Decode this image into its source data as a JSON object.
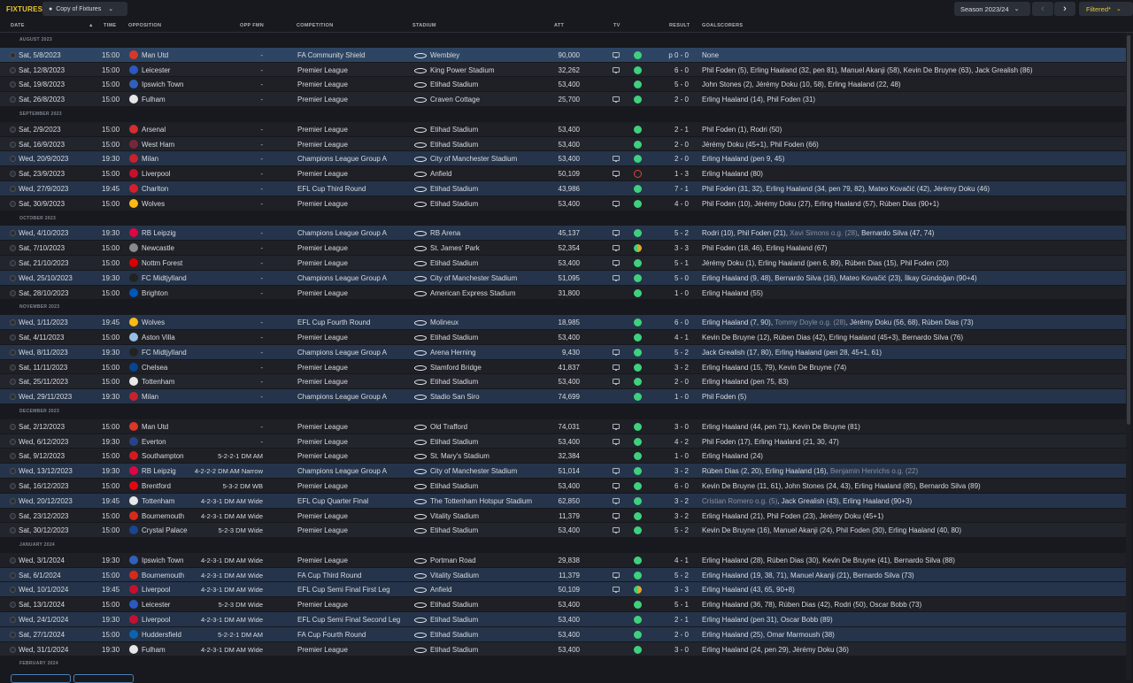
{
  "toolbar": {
    "title": "FIXTURES",
    "view_label": "Copy of Fixtures",
    "season_label": "Season 2023/24",
    "filter_label": "Filtered*"
  },
  "columns": {
    "date": "DATE",
    "time": "TIME",
    "opposition": "OPPOSITION",
    "opp_fmn": "OPP FMN",
    "competition": "COMPETITION",
    "stadium": "STADIUM",
    "att": "ATT",
    "tv": "TV",
    "result": "RESULT",
    "goalscorers": "GOALSCORERS"
  },
  "colors": {
    "accent": "#e8c533",
    "win": "#3fd07e",
    "draw": "#e3a52e",
    "loss": "#e2433b",
    "row_highlight": "#25344a"
  },
  "fixtures": [
    {
      "type": "section",
      "label": "AUGUST 2023"
    },
    {
      "type": "row",
      "date": "Sat, 5/8/2023",
      "time": "15:00",
      "opp": "Man Utd",
      "crest": "#d9372a",
      "fmn": "-",
      "comp": "FA Community Shield",
      "stadium": "Wembley",
      "att": "90,000",
      "tv": true,
      "status": "win",
      "result": "p 0 - 0",
      "goals": "None",
      "bg": "sel"
    },
    {
      "type": "row",
      "date": "Sat, 12/8/2023",
      "time": "15:00",
      "opp": "Leicester",
      "crest": "#2a59c4",
      "fmn": "-",
      "comp": "Premier League",
      "stadium": "King Power Stadium",
      "att": "32,262",
      "tv": true,
      "status": "win",
      "result": "6 - 0",
      "goals": "Phil Foden (5), Erling Haaland (32, pen 81), Manuel Akanji (58), Kevin De Bruyne (63), Jack Grealish (86)",
      "bg": "alt"
    },
    {
      "type": "row",
      "date": "Sat, 19/8/2023",
      "time": "15:00",
      "opp": "Ipswich Town",
      "crest": "#3160bb",
      "fmn": "-",
      "comp": "Premier League",
      "stadium": "Etihad Stadium",
      "att": "53,400",
      "tv": false,
      "status": "win",
      "result": "5 - 0",
      "goals": "John Stones (2), Jérémy Doku (10, 58), Erling Haaland (22, 48)",
      "bg": ""
    },
    {
      "type": "row",
      "date": "Sat, 26/8/2023",
      "time": "15:00",
      "opp": "Fulham",
      "crest": "#e6e6e6",
      "fmn": "-",
      "comp": "Premier League",
      "stadium": "Craven Cottage",
      "att": "25,700",
      "tv": true,
      "status": "win",
      "result": "2 - 0",
      "goals": "Erling Haaland (14), Phil Foden (31)",
      "bg": "alt"
    },
    {
      "type": "section",
      "label": "SEPTEMBER 2023"
    },
    {
      "type": "row",
      "date": "Sat, 2/9/2023",
      "time": "15:00",
      "opp": "Arsenal",
      "crest": "#d62d2d",
      "fmn": "-",
      "comp": "Premier League",
      "stadium": "Etihad Stadium",
      "att": "53,400",
      "tv": false,
      "status": "win",
      "result": "2 - 1",
      "goals": "Phil Foden (1), Rodri (50)",
      "bg": ""
    },
    {
      "type": "row",
      "date": "Sat, 16/9/2023",
      "time": "15:00",
      "opp": "West Ham",
      "crest": "#7a263a",
      "fmn": "-",
      "comp": "Premier League",
      "stadium": "Etihad Stadium",
      "att": "53,400",
      "tv": false,
      "status": "win",
      "result": "2 - 0",
      "goals": "Jérémy Doku (45+1), Phil Foden (66)",
      "bg": "alt"
    },
    {
      "type": "row",
      "date": "Wed, 20/9/2023",
      "time": "19:30",
      "opp": "Milan",
      "crest": "#c8232c",
      "fmn": "-",
      "comp": "Champions League Group A",
      "stadium": "City of Manchester Stadium",
      "att": "53,400",
      "tv": true,
      "status": "win",
      "result": "2 - 0",
      "goals": "Erling Haaland (pen 9, 45)",
      "bg": "hl"
    },
    {
      "type": "row",
      "date": "Sat, 23/9/2023",
      "time": "15:00",
      "opp": "Liverpool",
      "crest": "#c8102e",
      "fmn": "-",
      "comp": "Premier League",
      "stadium": "Anfield",
      "att": "50,109",
      "tv": true,
      "status": "loss",
      "result": "1 - 3",
      "goals": "Erling Haaland (80)",
      "bg": ""
    },
    {
      "type": "row",
      "date": "Wed, 27/9/2023",
      "time": "19:45",
      "opp": "Charlton",
      "crest": "#d4202c",
      "fmn": "-",
      "comp": "EFL Cup Third Round",
      "stadium": "Etihad Stadium",
      "att": "43,986",
      "tv": false,
      "status": "win",
      "result": "7 - 1",
      "goals": "Phil Foden (31, 32), Erling Haaland (34, pen 79, 82), Mateo Kovačić (42), Jérémy Doku (46)",
      "bg": "hl"
    },
    {
      "type": "row",
      "date": "Sat, 30/9/2023",
      "time": "15:00",
      "opp": "Wolves",
      "crest": "#fdb913",
      "fmn": "-",
      "comp": "Premier League",
      "stadium": "Etihad Stadium",
      "att": "53,400",
      "tv": true,
      "status": "win",
      "result": "4 - 0",
      "goals": "Phil Foden (10), Jérémy Doku (27), Erling Haaland (57), Rúben Dias (90+1)",
      "bg": ""
    },
    {
      "type": "section",
      "label": "OCTOBER 2023"
    },
    {
      "type": "row",
      "date": "Wed, 4/10/2023",
      "time": "19:30",
      "opp": "RB Leipzig",
      "crest": "#dd0741",
      "fmn": "-",
      "comp": "Champions League Group A",
      "stadium": "RB Arena",
      "att": "45,137",
      "tv": true,
      "status": "win",
      "result": "5 - 2",
      "goals": "Rodri (10), Phil Foden (21), ",
      "og": "Xavi Simons o.g. (28)",
      "goals2": ", Bernardo Silva (47, 74)",
      "bg": "hl"
    },
    {
      "type": "row",
      "date": "Sat, 7/10/2023",
      "time": "15:00",
      "opp": "Newcastle",
      "crest": "#8a8a8a",
      "fmn": "-",
      "comp": "Premier League",
      "stadium": "St. James' Park",
      "att": "52,354",
      "tv": true,
      "status": "draw",
      "result": "3 - 3",
      "goals": "Phil Foden (18, 46), Erling Haaland (67)",
      "bg": ""
    },
    {
      "type": "row",
      "date": "Sat, 21/10/2023",
      "time": "15:00",
      "opp": "Nottm Forest",
      "crest": "#dd0000",
      "fmn": "-",
      "comp": "Premier League",
      "stadium": "Etihad Stadium",
      "att": "53,400",
      "tv": true,
      "status": "win",
      "result": "5 - 1",
      "goals": "Jérémy Doku (1), Erling Haaland (pen 6, 89), Rúben Dias (15), Phil Foden (20)",
      "bg": "alt"
    },
    {
      "type": "row",
      "date": "Wed, 25/10/2023",
      "time": "19:30",
      "opp": "FC Midtjylland",
      "crest": "#222222",
      "fmn": "-",
      "comp": "Champions League Group A",
      "stadium": "City of Manchester Stadium",
      "att": "51,095",
      "tv": true,
      "status": "win",
      "result": "5 - 0",
      "goals": "Erling Haaland (9, 48), Bernardo Silva (16), Mateo Kovačić (23), İlkay Gündoğan (90+4)",
      "bg": "hl"
    },
    {
      "type": "row",
      "date": "Sat, 28/10/2023",
      "time": "15:00",
      "opp": "Brighton",
      "crest": "#0057b8",
      "fmn": "-",
      "comp": "Premier League",
      "stadium": "American Express Stadium",
      "att": "31,800",
      "tv": false,
      "status": "win",
      "result": "1 - 0",
      "goals": "Erling Haaland (55)",
      "bg": ""
    },
    {
      "type": "section",
      "label": "NOVEMBER 2023"
    },
    {
      "type": "row",
      "date": "Wed, 1/11/2023",
      "time": "19:45",
      "opp": "Wolves",
      "crest": "#fdb913",
      "fmn": "-",
      "comp": "EFL Cup Fourth Round",
      "stadium": "Molineux",
      "att": "18,985",
      "tv": false,
      "status": "win",
      "result": "6 - 0",
      "goals": "Erling Haaland (7, 90), ",
      "og": "Tommy Doyle o.g. (28)",
      "goals2": ", Jérémy Doku (56, 68), Rúben Dias (73)",
      "bg": "hl"
    },
    {
      "type": "row",
      "date": "Sat, 4/11/2023",
      "time": "15:00",
      "opp": "Aston Villa",
      "crest": "#95bfe5",
      "fmn": "-",
      "comp": "Premier League",
      "stadium": "Etihad Stadium",
      "att": "53,400",
      "tv": false,
      "status": "win",
      "result": "4 - 1",
      "goals": "Kevin De Bruyne (12), Rúben Dias (42), Erling Haaland (45+3), Bernardo Silva (76)",
      "bg": ""
    },
    {
      "type": "row",
      "date": "Wed, 8/11/2023",
      "time": "19:30",
      "opp": "FC Midtjylland",
      "crest": "#222222",
      "fmn": "-",
      "comp": "Champions League Group A",
      "stadium": "Arena Herning",
      "att": "9,430",
      "tv": true,
      "status": "win",
      "result": "5 - 2",
      "goals": "Jack Grealish (17, 80), Erling Haaland (pen 28, 45+1, 61)",
      "bg": "hl"
    },
    {
      "type": "row",
      "date": "Sat, 11/11/2023",
      "time": "15:00",
      "opp": "Chelsea",
      "crest": "#034694",
      "fmn": "-",
      "comp": "Premier League",
      "stadium": "Stamford Bridge",
      "att": "41,837",
      "tv": true,
      "status": "win",
      "result": "3 - 2",
      "goals": "Erling Haaland (15, 79), Kevin De Bruyne (74)",
      "bg": ""
    },
    {
      "type": "row",
      "date": "Sat, 25/11/2023",
      "time": "15:00",
      "opp": "Tottenham",
      "crest": "#e8e8e8",
      "fmn": "-",
      "comp": "Premier League",
      "stadium": "Etihad Stadium",
      "att": "53,400",
      "tv": true,
      "status": "win",
      "result": "2 - 0",
      "goals": "Erling Haaland (pen 75, 83)",
      "bg": "alt"
    },
    {
      "type": "row",
      "date": "Wed, 29/11/2023",
      "time": "19:30",
      "opp": "Milan",
      "crest": "#c8232c",
      "fmn": "-",
      "comp": "Champions League Group A",
      "stadium": "Stadio San Siro",
      "att": "74,699",
      "tv": false,
      "status": "win",
      "result": "1 - 0",
      "goals": "Phil Foden (5)",
      "bg": "hl"
    },
    {
      "type": "section",
      "label": "DECEMBER 2023"
    },
    {
      "type": "row",
      "date": "Sat, 2/12/2023",
      "time": "15:00",
      "opp": "Man Utd",
      "crest": "#d9372a",
      "fmn": "-",
      "comp": "Premier League",
      "stadium": "Old Trafford",
      "att": "74,031",
      "tv": true,
      "status": "win",
      "result": "3 - 0",
      "goals": "Erling Haaland (44, pen 71), Kevin De Bruyne (81)",
      "bg": ""
    },
    {
      "type": "row",
      "date": "Wed, 6/12/2023",
      "time": "19:30",
      "opp": "Everton",
      "crest": "#274488",
      "fmn": "-",
      "comp": "Premier League",
      "stadium": "Etihad Stadium",
      "att": "53,400",
      "tv": true,
      "status": "win",
      "result": "4 - 2",
      "goals": "Phil Foden (17), Erling Haaland (21, 30, 47)",
      "bg": "alt"
    },
    {
      "type": "row",
      "date": "Sat, 9/12/2023",
      "time": "15:00",
      "opp": "Southampton",
      "crest": "#d71920",
      "fmn": "5-2-2-1 DM AM",
      "comp": "Premier League",
      "stadium": "St. Mary's Stadium",
      "att": "32,384",
      "tv": false,
      "status": "win",
      "result": "1 - 0",
      "goals": "Erling Haaland (24)",
      "bg": ""
    },
    {
      "type": "row",
      "date": "Wed, 13/12/2023",
      "time": "19:30",
      "opp": "RB Leipzig",
      "crest": "#dd0741",
      "fmn": "4-2-2-2 DM AM Narrow",
      "comp": "Champions League Group A",
      "stadium": "City of Manchester Stadium",
      "att": "51,014",
      "tv": true,
      "status": "win",
      "result": "3 - 2",
      "goals": "Rúben Dias (2, 20), Erling Haaland (16), ",
      "og": "Benjamin Henrichs o.g. (22)",
      "goals2": "",
      "bg": "hl"
    },
    {
      "type": "row",
      "date": "Sat, 16/12/2023",
      "time": "15:00",
      "opp": "Brentford",
      "crest": "#e30613",
      "fmn": "5-3-2 DM WB",
      "comp": "Premier League",
      "stadium": "Etihad Stadium",
      "att": "53,400",
      "tv": true,
      "status": "win",
      "result": "6 - 0",
      "goals": "Kevin De Bruyne (11, 61), John Stones (24, 43), Erling Haaland (85), Bernardo Silva (89)",
      "bg": ""
    },
    {
      "type": "row",
      "date": "Wed, 20/12/2023",
      "time": "19:45",
      "opp": "Tottenham",
      "crest": "#e8e8e8",
      "fmn": "4-2-3-1 DM AM Wide",
      "comp": "EFL Cup Quarter Final",
      "stadium": "The Tottenham Hotspur Stadium",
      "att": "62,850",
      "tv": true,
      "status": "win",
      "result": "3 - 2",
      "goals": "",
      "og": "Cristian Romero o.g. (5)",
      "goals2": ", Jack Grealish (43), Erling Haaland (90+3)",
      "bg": "hl"
    },
    {
      "type": "row",
      "date": "Sat, 23/12/2023",
      "time": "15:00",
      "opp": "Bournemouth",
      "crest": "#da291c",
      "fmn": "4-2-3-1 DM AM Wide",
      "comp": "Premier League",
      "stadium": "Vitality Stadium",
      "att": "11,379",
      "tv": true,
      "status": "win",
      "result": "3 - 2",
      "goals": "Erling Haaland (21), Phil Foden (23), Jérémy Doku (45+1)",
      "bg": ""
    },
    {
      "type": "row",
      "date": "Sat, 30/12/2023",
      "time": "15:00",
      "opp": "Crystal Palace",
      "crest": "#1b458f",
      "fmn": "5-2-3 DM Wide",
      "comp": "Premier League",
      "stadium": "Etihad Stadium",
      "att": "53,400",
      "tv": true,
      "status": "win",
      "result": "5 - 2",
      "goals": "Kevin De Bruyne (16), Manuel Akanji (24), Phil Foden (30), Erling Haaland (40, 80)",
      "bg": "alt"
    },
    {
      "type": "section",
      "label": "JANUARY 2024"
    },
    {
      "type": "row",
      "date": "Wed, 3/1/2024",
      "time": "19:30",
      "opp": "Ipswich Town",
      "crest": "#3160bb",
      "fmn": "4-2-3-1 DM AM Wide",
      "comp": "Premier League",
      "stadium": "Portman Road",
      "att": "29,838",
      "tv": false,
      "status": "win",
      "result": "4 - 1",
      "goals": "Erling Haaland (28), Rúben Dias (30), Kevin De Bruyne (41), Bernardo Silva (88)",
      "bg": ""
    },
    {
      "type": "row",
      "date": "Sat, 6/1/2024",
      "time": "15:00",
      "opp": "Bournemouth",
      "crest": "#da291c",
      "fmn": "4-2-3-1 DM AM Wide",
      "comp": "FA Cup Third Round",
      "stadium": "Vitality Stadium",
      "att": "11,379",
      "tv": true,
      "status": "win",
      "result": "5 - 2",
      "goals": "Erling Haaland (19, 38, 71), Manuel Akanji (21), Bernardo Silva (73)",
      "bg": "hl"
    },
    {
      "type": "row",
      "date": "Wed, 10/1/2024",
      "time": "19:45",
      "opp": "Liverpool",
      "crest": "#c8102e",
      "fmn": "4-2-3-1 DM AM Wide",
      "comp": "EFL Cup Semi Final First Leg",
      "stadium": "Anfield",
      "att": "50,109",
      "tv": true,
      "status": "draw",
      "result": "3 - 3",
      "goals": "Erling Haaland (43, 65, 90+8)",
      "bg": "hl"
    },
    {
      "type": "row",
      "date": "Sat, 13/1/2024",
      "time": "15:00",
      "opp": "Leicester",
      "crest": "#2a59c4",
      "fmn": "5-2-3 DM Wide",
      "comp": "Premier League",
      "stadium": "Etihad Stadium",
      "att": "53,400",
      "tv": false,
      "status": "win",
      "result": "5 - 1",
      "goals": "Erling Haaland (36, 78), Rúben Dias (42), Rodri (50), Oscar Bobb (73)",
      "bg": ""
    },
    {
      "type": "row",
      "date": "Wed, 24/1/2024",
      "time": "19:30",
      "opp": "Liverpool",
      "crest": "#c8102e",
      "fmn": "4-2-3-1 DM AM Wide",
      "comp": "EFL Cup Semi Final Second Leg",
      "stadium": "Etihad Stadium",
      "att": "53,400",
      "tv": false,
      "status": "win",
      "result": "2 - 1",
      "goals": "Erling Haaland (pen 31), Oscar Bobb (89)",
      "bg": "hl"
    },
    {
      "type": "row",
      "date": "Sat, 27/1/2024",
      "time": "15:00",
      "opp": "Huddersfield",
      "crest": "#0e63ad",
      "fmn": "5-2-2-1 DM AM",
      "comp": "FA Cup Fourth Round",
      "stadium": "Etihad Stadium",
      "att": "53,400",
      "tv": false,
      "status": "win",
      "result": "2 - 0",
      "goals": "Erling Haaland (25), Omar Marmoush (38)",
      "bg": "hl"
    },
    {
      "type": "row",
      "date": "Wed, 31/1/2024",
      "time": "19:30",
      "opp": "Fulham",
      "crest": "#e6e6e6",
      "fmn": "4-2-3-1 DM AM Wide",
      "comp": "Premier League",
      "stadium": "Etihad Stadium",
      "att": "53,400",
      "tv": false,
      "status": "win",
      "result": "3 - 0",
      "goals": "Erling Haaland (24, pen 29), Jérémy Doku (36)",
      "bg": "alt"
    },
    {
      "type": "section",
      "label": "FEBRUARY 2024"
    }
  ]
}
